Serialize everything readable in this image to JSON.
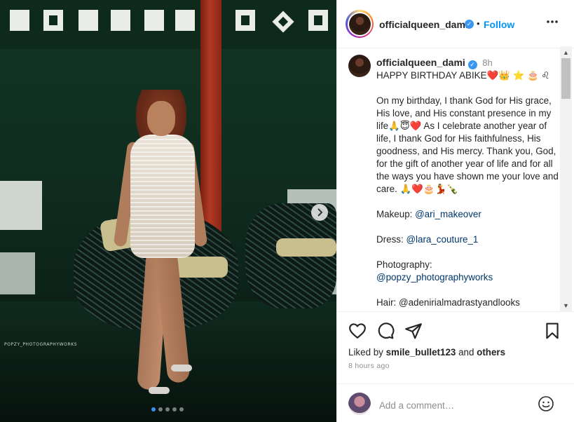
{
  "photo": {
    "watermark": "POPZY_PHOTOGRAPHYWORKS",
    "next_icon": "chevron-right-icon",
    "carousel": {
      "count": 5,
      "active_index": 0
    },
    "active_dot_color": "#3f8cf1"
  },
  "header": {
    "username": "officialqueen_dami",
    "verified_icon": "verified-badge-icon",
    "separator": "•",
    "follow_label": "Follow",
    "more_icon": "more-horizontal-icon"
  },
  "caption": {
    "username": "officialqueen_dami",
    "time": "8h",
    "first_line": "HAPPY BIRTHDAY ABIKE❤️👑 ⭐ 🎂 ♌",
    "message": "On my birthday, I thank God for His grace, His love, and His constant presence in my life🙏😇❤️ As I celebrate another year of life, I thank God for His faithfulness, His goodness, and His mercy. Thank you, God, for the gift of another year of life and for all the ways you have shown me your love and care. 🙏❤️🎂💃🍾",
    "makeup_label": "Makeup:",
    "makeup_link": "@ari_makeover",
    "dress_label": "Dress:",
    "dress_link": "@lara_couture_1",
    "photography_label": "Photography:",
    "photography_link": "@popzy_photographyworks",
    "partial_line": "Hair: @adenirialmadrastyandlooks"
  },
  "actions": {
    "like_icon": "heart-icon",
    "comment_icon": "comment-icon",
    "share_icon": "send-icon",
    "save_icon": "bookmark-icon",
    "liked_prefix": "Liked by",
    "liked_user": "smile_bullet123",
    "liked_and": "and",
    "liked_others": "others",
    "time_ago": "8 hours ago"
  },
  "comment": {
    "placeholder": "Add a comment…",
    "emoji_icon": "smiley-icon"
  },
  "scrollbar": {
    "up_icon": "scroll-up-arrow-icon",
    "down_icon": "scroll-down-arrow-icon"
  },
  "colors": {
    "link": "#00376b",
    "follow": "#0095f6",
    "verified": "#3897f0",
    "muted": "#8e8e8e"
  }
}
